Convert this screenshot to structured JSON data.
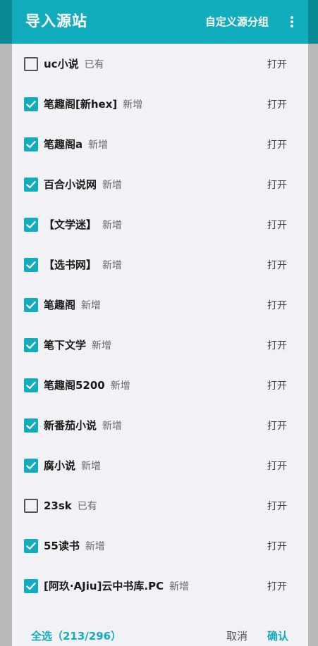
{
  "toolbar": {
    "title": "导入源站",
    "custom_group": "自定义源分组",
    "more_icon": "more-vert-icon"
  },
  "colors": {
    "accent": "#12adbd",
    "dialog_bg": "#f1f1f6",
    "scrim": "#a9a9a9"
  },
  "items": [
    {
      "name": "uc小说",
      "status": "已有",
      "checked": false,
      "action": "打开"
    },
    {
      "name": "笔趣阁[新hex]",
      "status": "新增",
      "checked": true,
      "action": "打开"
    },
    {
      "name": "笔趣阁a",
      "status": "新增",
      "checked": true,
      "action": "打开"
    },
    {
      "name": "百合小说网",
      "status": "新增",
      "checked": true,
      "action": "打开"
    },
    {
      "name": "【文学迷】",
      "status": "新增",
      "checked": true,
      "action": "打开"
    },
    {
      "name": "【选书网】",
      "status": "新增",
      "checked": true,
      "action": "打开"
    },
    {
      "name": "笔趣阁",
      "status": "新增",
      "checked": true,
      "action": "打开"
    },
    {
      "name": "笔下文学",
      "status": "新增",
      "checked": true,
      "action": "打开"
    },
    {
      "name": "笔趣阁5200",
      "status": "新增",
      "checked": true,
      "action": "打开"
    },
    {
      "name": "新番茄小说",
      "status": "新增",
      "checked": true,
      "action": "打开"
    },
    {
      "name": "腐小说",
      "status": "新增",
      "checked": true,
      "action": "打开"
    },
    {
      "name": "23sk",
      "status": "已有",
      "checked": false,
      "action": "打开"
    },
    {
      "name": "55读书",
      "status": "新增",
      "checked": true,
      "action": "打开"
    },
    {
      "name": "[阿玖·AJiu]云中书库.PC",
      "status": "新增",
      "checked": true,
      "action": "打开"
    }
  ],
  "footer": {
    "select_all": "全选（213/296）",
    "cancel": "取消",
    "confirm": "确认"
  }
}
